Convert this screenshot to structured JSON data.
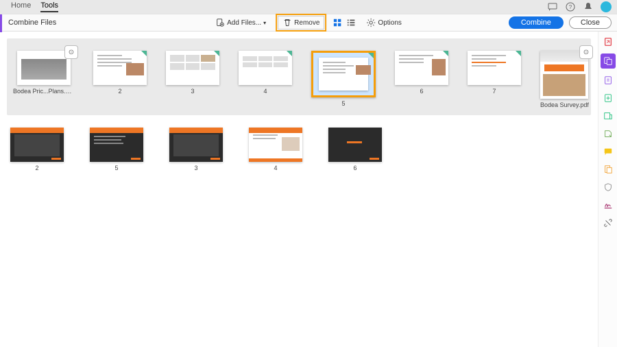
{
  "topbar": {
    "tabs": [
      {
        "label": "Home",
        "active": false
      },
      {
        "label": "Tools",
        "active": true
      }
    ]
  },
  "toolbar": {
    "title": "Combine Files",
    "addFiles": "Add Files...",
    "remove": "Remove",
    "options": "Options",
    "combine": "Combine",
    "close": "Close"
  },
  "groups": {
    "row1": [
      {
        "name": "Bodea Pric...Plans.pptx",
        "pages": "",
        "moreBtn": true,
        "type": "photo"
      },
      {
        "name": "",
        "pages": "2",
        "type": "lines-img"
      },
      {
        "name": "",
        "pages": "3",
        "type": "grid"
      },
      {
        "name": "",
        "pages": "4",
        "type": "grid"
      },
      {
        "name": "",
        "pages": "5",
        "type": "lines-img",
        "selected": true
      },
      {
        "name": "",
        "pages": "6",
        "type": "lines-img"
      },
      {
        "name": "",
        "pages": "7",
        "type": "lines"
      },
      {
        "name": "Bodea Survey.pdf",
        "pages": "",
        "moreBtn": true,
        "type": "survey",
        "long": true
      }
    ],
    "row2": [
      {
        "pages": "2",
        "type": "dark-photo"
      },
      {
        "pages": "5",
        "type": "dark-lines"
      },
      {
        "pages": "3",
        "type": "dark-photo"
      },
      {
        "pages": "4",
        "type": "dark-lines-img"
      },
      {
        "pages": "6",
        "type": "dark-center"
      }
    ]
  },
  "railIcons": [
    {
      "name": "export-pdf-icon",
      "color": "#e34850"
    },
    {
      "name": "combine-icon",
      "active": true,
      "color": "#fff"
    },
    {
      "name": "edit-pdf-icon",
      "color": "#864ae6"
    },
    {
      "name": "request-sign-icon",
      "color": "#1bbf7a"
    },
    {
      "name": "tool-a-icon",
      "color": "#1bbf7a"
    },
    {
      "name": "tool-b-icon",
      "color": "#6aa84f"
    },
    {
      "name": "comment-icon",
      "color": "#f5c518"
    },
    {
      "name": "tool-c-icon",
      "color": "#f0a030"
    },
    {
      "name": "shield-icon",
      "color": "#888"
    },
    {
      "name": "sign-icon",
      "color": "#b0487e"
    },
    {
      "name": "more-tools-icon",
      "color": "#555"
    }
  ]
}
